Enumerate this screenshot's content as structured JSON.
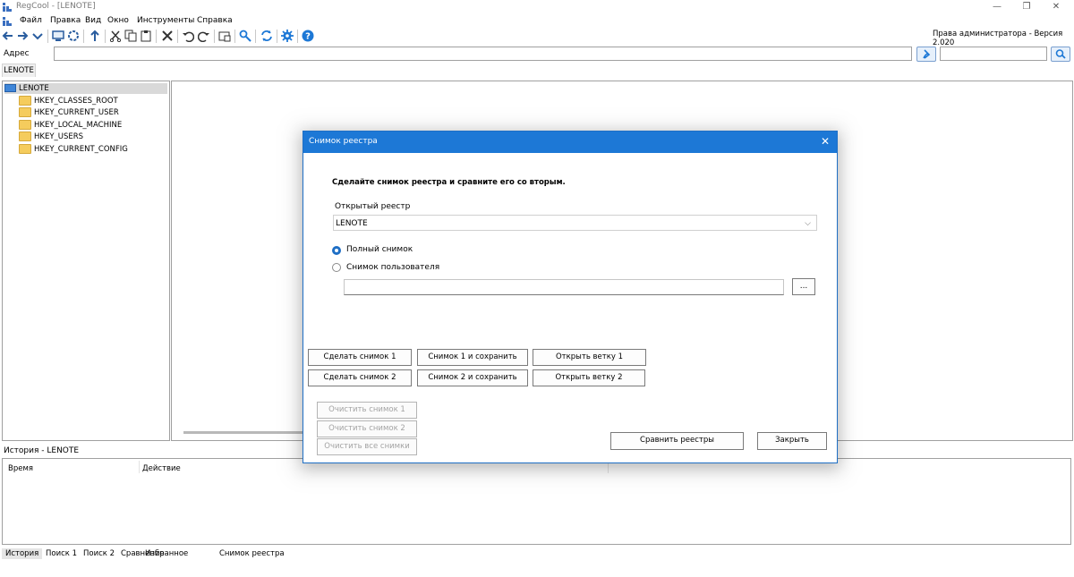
{
  "window": {
    "title": "RegCool - [LENOTE]",
    "minimize_glyph": "—",
    "maximize_glyph": "❐",
    "close_glyph": "✕"
  },
  "menu": [
    "Файл",
    "Правка",
    "Вид",
    "Окно",
    "Инструменты",
    "Справка"
  ],
  "toolbar": {
    "version_text": "Права администратора - Версия 2.020",
    "icons": [
      "back-icon",
      "forward-icon",
      "dropdown-icon",
      "computer-icon",
      "refresh-icon",
      "up-icon",
      "cut-icon",
      "copy-icon",
      "paste-icon",
      "delete-icon",
      "undo-icon",
      "redo-icon",
      "new-key-icon",
      "find-icon",
      "sync-icon",
      "settings-icon",
      "help-icon"
    ]
  },
  "address": {
    "label": "Адрес",
    "value": "",
    "search_value": ""
  },
  "computer_tab": "LENOTE",
  "tree": {
    "root": "LENOTE",
    "items": [
      "HKEY_CLASSES_ROOT",
      "HKEY_CURRENT_USER",
      "HKEY_LOCAL_MACHINE",
      "HKEY_USERS",
      "HKEY_CURRENT_CONFIG"
    ]
  },
  "history": {
    "title": "История - LENOTE",
    "columns": [
      "Время",
      "Действие"
    ]
  },
  "bottom_tabs": [
    "История",
    "Поиск 1",
    "Поиск 2",
    "Сравнение",
    "Избранное",
    "Снимок реестра"
  ],
  "dialog": {
    "title": "Снимок реестра",
    "close_glyph": "✕",
    "instruction": "Сделайте снимок реестра и сравните его со вторым.",
    "open_registry_label": "Открытый реестр",
    "selected_registry": "LENOTE",
    "radio_full": "Полный снимок",
    "radio_user": "Снимок пользователя",
    "snapshot_path": "",
    "browse_label": "...",
    "buttons": {
      "take1": "Сделать снимок 1",
      "take2": "Сделать снимок 2",
      "save1": "Снимок 1 и сохранить",
      "save2": "Снимок 2 и сохранить",
      "open1": "Открыть ветку 1",
      "open2": "Открыть ветку 2",
      "clear1": "Очистить снимок 1",
      "clear2": "Очистить снимок 2",
      "clear_all": "Очистить все снимки",
      "compare": "Сравнить реестры",
      "close": "Закрыть"
    }
  },
  "colors": {
    "accent": "#1d78d6",
    "folder": "#f5cc5d",
    "selection": "#d9d9d9"
  }
}
